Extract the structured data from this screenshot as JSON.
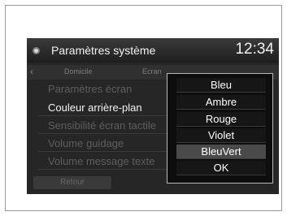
{
  "header": {
    "title": "Paramètres système",
    "clock": "12:34",
    "icon": "settings-icon"
  },
  "tabs": [
    {
      "label": "Domicile"
    },
    {
      "label": "Ecran"
    }
  ],
  "menu": {
    "items": [
      {
        "label": "Paramètres écran"
      },
      {
        "label": "Couleur arrière-plan"
      },
      {
        "label": "Sensibilité écran tactile"
      },
      {
        "label": "Volume guidage"
      },
      {
        "label": "Volume message texte"
      }
    ],
    "selected_index": 1,
    "back_label": "Retour"
  },
  "popup": {
    "options": [
      "Bleu",
      "Ambre",
      "Rouge",
      "Violet",
      "BleuVert",
      "OK"
    ],
    "selected": "BleuVert"
  },
  "colors": {
    "screen_bg": "#262626",
    "popup_bg": "#0d0d0d",
    "selected_text": "#f4f4f4",
    "dim_text": "#5e5e5e"
  }
}
